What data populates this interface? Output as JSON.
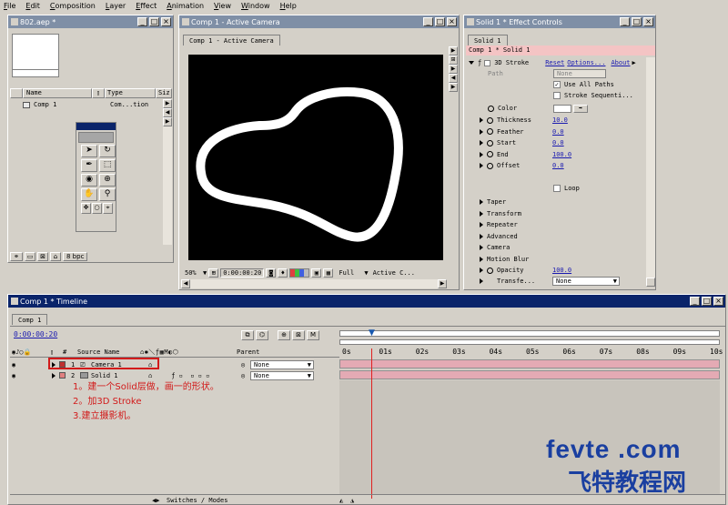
{
  "menu": [
    "File",
    "Edit",
    "Composition",
    "Layer",
    "Effect",
    "Animation",
    "View",
    "Window",
    "Help"
  ],
  "project": {
    "title": "802.aep *",
    "columns": [
      "Name",
      "Type",
      "Siz"
    ],
    "items": [
      {
        "name": "Comp 1",
        "type": "Com...tion"
      }
    ],
    "bpc": "8 bpc"
  },
  "comp": {
    "title": "Comp 1 - Active Camera",
    "tab": "Comp 1 - Active Camera",
    "zoom": "50%",
    "timecode": "0:00:00:20",
    "resolution": "Full",
    "camera": "Active C..."
  },
  "effects": {
    "title": "Solid 1 * Effect Controls",
    "tab": "Solid 1",
    "layer_line": "Comp 1 * Solid 1",
    "effect_name": "3D Stroke",
    "reset": "Reset",
    "options": "Options...",
    "about": "About",
    "path_label": "Path",
    "path_value": "None",
    "use_all_paths": "Use All Paths",
    "stroke_seq": "Stroke Sequenti...",
    "color_label": "Color",
    "params": [
      {
        "label": "Thickness",
        "value": "10.0"
      },
      {
        "label": "Feather",
        "value": "0.0"
      },
      {
        "label": "Start",
        "value": "0.0"
      },
      {
        "label": "End",
        "value": "100.0"
      },
      {
        "label": "Offset",
        "value": "0.0"
      }
    ],
    "loop": "Loop",
    "groups": [
      "Taper",
      "Transform",
      "Repeater",
      "Advanced",
      "Camera",
      "Motion Blur"
    ],
    "opacity_label": "Opacity",
    "opacity_value": "100.0",
    "transfer_label": "Transfe...",
    "transfer_value": "None"
  },
  "timeline": {
    "title": "Comp 1 * Timeline",
    "tab": "Comp 1",
    "timecode": "0:00:00:20",
    "col_hash": "#",
    "col_source": "Source Name",
    "col_parent": "Parent",
    "ruler": [
      "0s",
      "01s",
      "02s",
      "03s",
      "04s",
      "05s",
      "06s",
      "07s",
      "08s",
      "09s",
      "10s"
    ],
    "layers": [
      {
        "num": "1",
        "name": "Camera 1",
        "parent": "None"
      },
      {
        "num": "2",
        "name": "Solid 1",
        "parent": "None"
      }
    ],
    "switches": "Switches / Modes",
    "playhead_fraction": 0.083
  },
  "notes": [
    "1。建一个Solid层做，画一的形状。",
    "2。加3D Stroke",
    "3.建立摄影机。"
  ],
  "watermark": {
    "line1": "fevte .com",
    "line2": "飞特教程网"
  }
}
